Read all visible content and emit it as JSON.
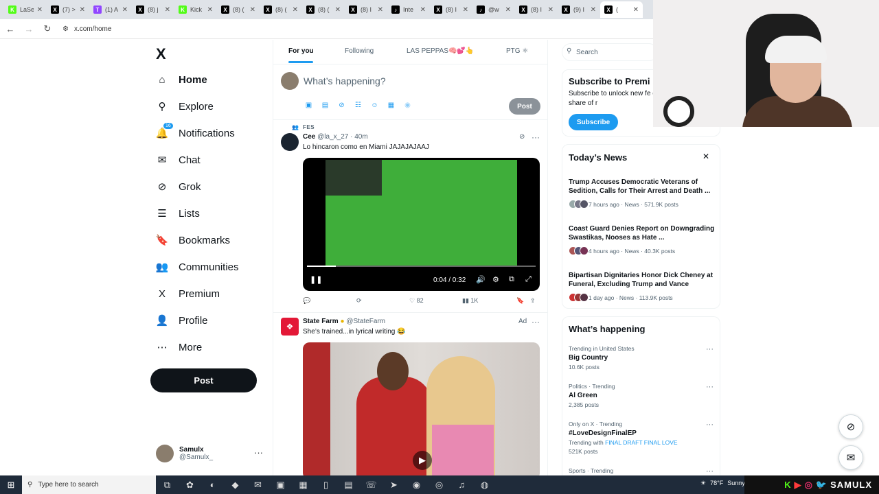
{
  "browser": {
    "tabs": [
      {
        "label": "LaSe",
        "color": "#53fc18",
        "glyph": "K"
      },
      {
        "label": "(7) >",
        "color": "#000000",
        "glyph": "X"
      },
      {
        "label": "(1) A",
        "color": "#9146ff",
        "glyph": "T"
      },
      {
        "label": "(8) j",
        "color": "#000000",
        "glyph": "X"
      },
      {
        "label": "Kick",
        "color": "#53fc18",
        "glyph": "K"
      },
      {
        "label": "(8) (",
        "color": "#000000",
        "glyph": "X"
      },
      {
        "label": "(8) (",
        "color": "#000000",
        "glyph": "X"
      },
      {
        "label": "(8) (",
        "color": "#000000",
        "glyph": "X"
      },
      {
        "label": "(8) I",
        "color": "#000000",
        "glyph": "X"
      },
      {
        "label": "Inte",
        "color": "#000000",
        "glyph": "♪"
      },
      {
        "label": "(8) I",
        "color": "#000000",
        "glyph": "X"
      },
      {
        "label": "@w",
        "color": "#000000",
        "glyph": "♪"
      },
      {
        "label": "(8) I",
        "color": "#000000",
        "glyph": "X"
      },
      {
        "label": "(9) I",
        "color": "#000000",
        "glyph": "X"
      },
      {
        "label": "(",
        "color": "#000000",
        "glyph": "X"
      }
    ],
    "url": "x.com/home"
  },
  "nav": {
    "logo": "X",
    "items": [
      {
        "label": "Home",
        "icon": "home-icon",
        "glyph": "⌂",
        "active": true
      },
      {
        "label": "Explore",
        "icon": "search-icon",
        "glyph": "⚲",
        "active": false
      },
      {
        "label": "Notifications",
        "icon": "bell-icon",
        "glyph": "🔔",
        "active": false,
        "badge": "16"
      },
      {
        "label": "Chat",
        "icon": "mail-icon",
        "glyph": "✉",
        "active": false
      },
      {
        "label": "Grok",
        "icon": "grok-icon",
        "glyph": "⊘",
        "active": false
      },
      {
        "label": "Lists",
        "icon": "list-icon",
        "glyph": "☰",
        "active": false
      },
      {
        "label": "Bookmarks",
        "icon": "bookmark-icon",
        "glyph": "🔖",
        "active": false
      },
      {
        "label": "Communities",
        "icon": "people-icon",
        "glyph": "👥",
        "active": false
      },
      {
        "label": "Premium",
        "icon": "x-icon",
        "glyph": "X",
        "active": false
      },
      {
        "label": "Profile",
        "icon": "person-icon",
        "glyph": "👤",
        "active": false
      },
      {
        "label": "More",
        "icon": "more-icon",
        "glyph": "⋯",
        "active": false
      }
    ],
    "post_label": "Post",
    "account": {
      "name": "Samulx",
      "handle": "@Samulx_",
      "more": "···"
    }
  },
  "feed": {
    "tabs": [
      {
        "label": "For you",
        "active": true
      },
      {
        "label": "Following",
        "active": false
      },
      {
        "label": "LAS PEPPAS🧠💕👆",
        "active": false
      },
      {
        "label": "PTG ⚛",
        "active": false
      }
    ],
    "compose": {
      "placeholder": "What’s happening?",
      "post_label": "Post"
    },
    "tweets": [
      {
        "context": "FES",
        "name": "Cee",
        "handle": "@la_x_27",
        "time": "· 40m",
        "text": "Lo hincaron como en Miami JAJAJAJAAJ",
        "video_time": "0:04 / 0:32",
        "video_progress": 0.125,
        "replies": "",
        "reposts": "",
        "likes": "82",
        "views": "1K"
      },
      {
        "name": "State Farm",
        "handle": "@StateFarm",
        "ad_label": "Ad",
        "text": "She’s trained...in lyrical writing 😂"
      }
    ]
  },
  "right": {
    "search_placeholder": "Search",
    "subscribe": {
      "title": "Subscribe to Premi",
      "text": "Subscribe to unlock new fe eligible, receive a share of r",
      "button": "Subscribe"
    },
    "news": {
      "title": "Today’s News",
      "items": [
        {
          "title": "Trump Accuses Democratic Veterans of Sedition, Calls for Their Arrest and Death ...",
          "meta": "7 hours ago · News · 571.9K posts"
        },
        {
          "title": "Coast Guard Denies Report on Downgrading Swastikas, Nooses as Hate ...",
          "meta": "4 hours ago · News · 40.3K posts"
        },
        {
          "title": "Bipartisan Dignitaries Honor Dick Cheney at Funeral, Excluding Trump and Vance",
          "meta": "1 day ago · News · 113.9K posts"
        }
      ]
    },
    "happening": {
      "title": "What’s happening",
      "items": [
        {
          "category": "Trending in United States",
          "name": "Big Country",
          "count": "10.6K posts"
        },
        {
          "category": "Politics · Trending",
          "name": "Al Green",
          "count": "2,385 posts"
        },
        {
          "category": "Only on X · Trending",
          "name": "#LoveDesignFinalEP",
          "trending_with": "Trending with",
          "trending_link": "FINAL DRAFT FINAL LOVE",
          "count": "521K posts"
        },
        {
          "category": "Sports · Trending",
          "name": "",
          "count": ""
        }
      ]
    }
  },
  "taskbar": {
    "search_placeholder": "Type here to search",
    "weather": "78°F",
    "weather_desc": "Sunny",
    "overlay_name": "SAMULX"
  }
}
